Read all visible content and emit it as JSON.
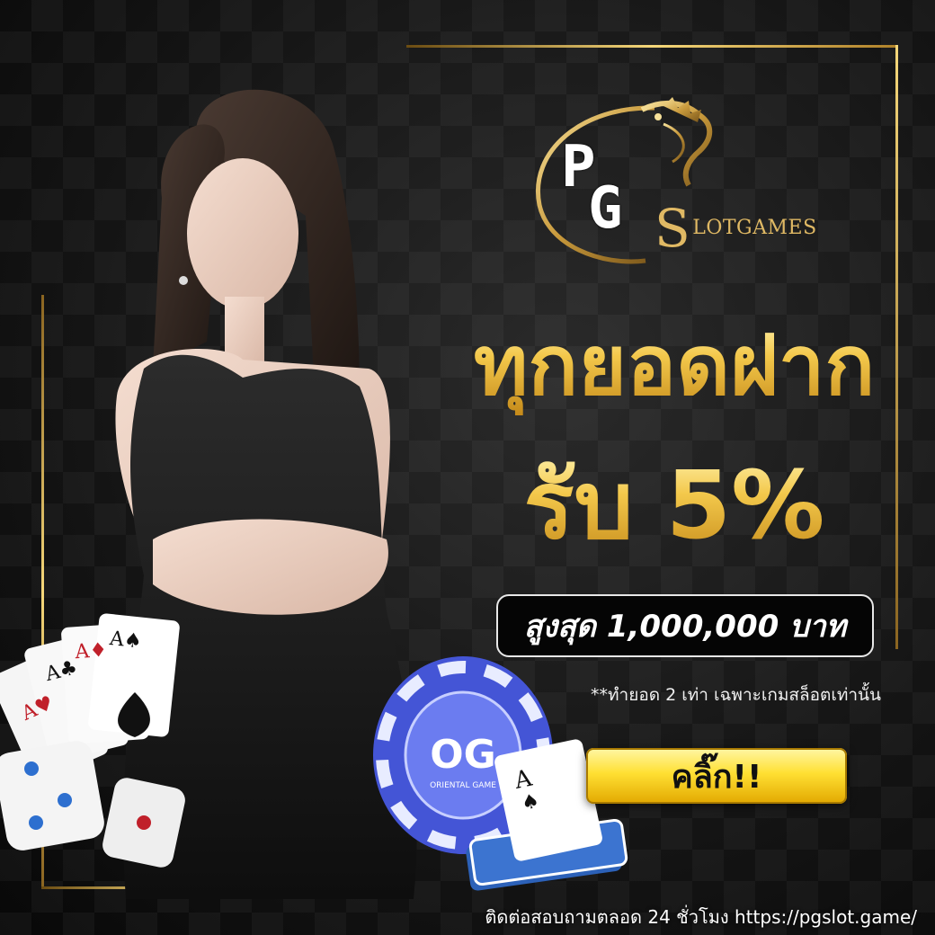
{
  "brand": {
    "logo_p": "P",
    "logo_g": "G",
    "logo_s": "S",
    "logo_rest": "LOTGAMES",
    "accent_color": "#e0b964"
  },
  "promo": {
    "headline_line1": "ทุกยอดฝาก",
    "headline_line2": "รับ 5%",
    "cap_text": "สูงสุด 1,000,000 บาท",
    "fineprint": "**ทำยอด 2 เท่า เฉพาะเกมสล็อตเท่านั้น"
  },
  "cta": {
    "label": "คลิ๊ก!!"
  },
  "footer": {
    "contact": "ติดต่อสอบถามตลอด 24 ชั่วโมง https://pgslot.game/"
  },
  "props": {
    "chip_logo_letters": "OG",
    "chip_caption": "ORIENTAL GAME",
    "card_rank": "A"
  }
}
